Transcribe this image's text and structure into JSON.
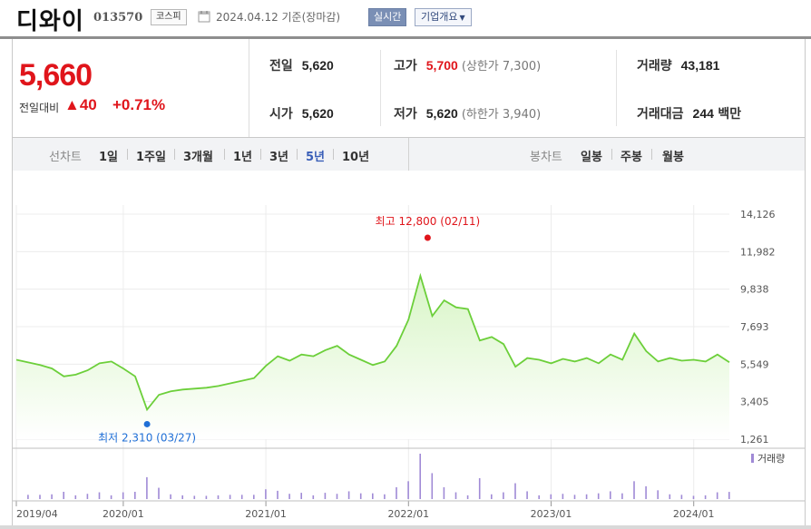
{
  "header": {
    "stock_name": "디와이",
    "stock_code": "013570",
    "market": "코스피",
    "date_text": "2024.04.12 기준(장마감)",
    "realtime_label": "실시간",
    "company_label": "기업개요"
  },
  "quote": {
    "price": "5,660",
    "diff_label": "전일대비",
    "diff_value": "▲40",
    "diff_pct": "+0.71%",
    "prev_close_label": "전일",
    "prev_close": "5,620",
    "open_label": "시가",
    "open": "5,620",
    "high_label": "고가",
    "high": "5,700",
    "upper_limit": "(상한가 7,300)",
    "low_label": "저가",
    "low": "5,620",
    "lower_limit": "(하한가 3,940)",
    "volume_label": "거래량",
    "volume": "43,181",
    "amount_label": "거래대금",
    "amount": "244",
    "amount_unit": "백만"
  },
  "tabs": {
    "line_label": "선차트",
    "line_tabs": [
      "1일",
      "1주일",
      "3개월",
      "1년",
      "3년",
      "5년",
      "10년"
    ],
    "line_active": 5,
    "candle_label": "봉차트",
    "candle_tabs": [
      "일봉",
      "주봉",
      "월봉"
    ]
  },
  "colors": {
    "up": "#e0151b",
    "line": "#6ccf3a",
    "area_top": "#d8f5c6",
    "area_bottom": "#ffffff",
    "low_marker": "#1f6fd6",
    "high_marker": "#e0151b",
    "volume_bar": "#a08ad6"
  },
  "chart_data": {
    "type": "area",
    "y_ticks": [
      "14,126",
      "11,982",
      "9,838",
      "7,693",
      "5,549",
      "3,405",
      "1,261"
    ],
    "ylim": [
      1261,
      14126
    ],
    "x_ticks": [
      "2019/04",
      "2020/01",
      "2021/01",
      "2022/01",
      "2023/01",
      "2024/01"
    ],
    "high_annotation": "최고 12,800 (02/11)",
    "low_annotation": "최저 2,310 (03/27)",
    "volume_legend": "거래량",
    "series": [
      {
        "values": [
          {
            "x": "2019/04",
            "y": 5800
          },
          {
            "x": "2019/05",
            "y": 5650
          },
          {
            "x": "2019/06",
            "y": 5500
          },
          {
            "x": "2019/07",
            "y": 5300
          },
          {
            "x": "2019/08",
            "y": 4850
          },
          {
            "x": "2019/09",
            "y": 4950
          },
          {
            "x": "2019/10",
            "y": 5200
          },
          {
            "x": "2019/11",
            "y": 5600
          },
          {
            "x": "2019/12",
            "y": 5700
          },
          {
            "x": "2020/01",
            "y": 5300
          },
          {
            "x": "2020/02",
            "y": 4850
          },
          {
            "x": "2020/03",
            "y": 2950
          },
          {
            "x": "2020/04",
            "y": 3800
          },
          {
            "x": "2020/05",
            "y": 4000
          },
          {
            "x": "2020/06",
            "y": 4100
          },
          {
            "x": "2020/07",
            "y": 4150
          },
          {
            "x": "2020/08",
            "y": 4200
          },
          {
            "x": "2020/09",
            "y": 4300
          },
          {
            "x": "2020/10",
            "y": 4450
          },
          {
            "x": "2020/11",
            "y": 4600
          },
          {
            "x": "2020/12",
            "y": 4750
          },
          {
            "x": "2021/01",
            "y": 5450
          },
          {
            "x": "2021/02",
            "y": 6000
          },
          {
            "x": "2021/03",
            "y": 5750
          },
          {
            "x": "2021/04",
            "y": 6100
          },
          {
            "x": "2021/05",
            "y": 6000
          },
          {
            "x": "2021/06",
            "y": 6350
          },
          {
            "x": "2021/07",
            "y": 6600
          },
          {
            "x": "2021/08",
            "y": 6100
          },
          {
            "x": "2021/09",
            "y": 5800
          },
          {
            "x": "2021/10",
            "y": 5500
          },
          {
            "x": "2021/11",
            "y": 5700
          },
          {
            "x": "2021/12",
            "y": 6600
          },
          {
            "x": "2022/01",
            "y": 8100
          },
          {
            "x": "2022/02",
            "y": 10600
          },
          {
            "x": "2022/03",
            "y": 8300
          },
          {
            "x": "2022/04",
            "y": 9200
          },
          {
            "x": "2022/05",
            "y": 8800
          },
          {
            "x": "2022/06",
            "y": 8700
          },
          {
            "x": "2022/07",
            "y": 6900
          },
          {
            "x": "2022/08",
            "y": 7100
          },
          {
            "x": "2022/09",
            "y": 6700
          },
          {
            "x": "2022/10",
            "y": 5400
          },
          {
            "x": "2022/11",
            "y": 5900
          },
          {
            "x": "2022/12",
            "y": 5800
          },
          {
            "x": "2023/01",
            "y": 5600
          },
          {
            "x": "2023/02",
            "y": 5850
          },
          {
            "x": "2023/03",
            "y": 5700
          },
          {
            "x": "2023/04",
            "y": 5900
          },
          {
            "x": "2023/05",
            "y": 5600
          },
          {
            "x": "2023/06",
            "y": 6100
          },
          {
            "x": "2023/07",
            "y": 5800
          },
          {
            "x": "2023/08",
            "y": 7300
          },
          {
            "x": "2023/09",
            "y": 6300
          },
          {
            "x": "2023/10",
            "y": 5700
          },
          {
            "x": "2023/11",
            "y": 5900
          },
          {
            "x": "2023/12",
            "y": 5750
          },
          {
            "x": "2024/01",
            "y": 5800
          },
          {
            "x": "2024/02",
            "y": 5700
          },
          {
            "x": "2024/03",
            "y": 6100
          },
          {
            "x": "2024/04",
            "y": 5660
          }
        ]
      }
    ]
  }
}
